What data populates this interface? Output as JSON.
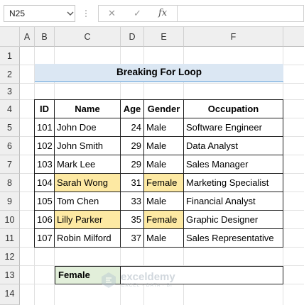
{
  "formula_bar": {
    "name_box": "N25",
    "cancel_symbol": "✕",
    "enter_symbol": "✓",
    "fx_symbol": "fx",
    "formula": ""
  },
  "columns": [
    "A",
    "B",
    "C",
    "D",
    "E",
    "F"
  ],
  "rows": [
    "1",
    "2",
    "3",
    "4",
    "5",
    "6",
    "7",
    "8",
    "9",
    "10",
    "11",
    "12",
    "13",
    "14"
  ],
  "title": "Breaking For Loop",
  "table": {
    "headers": [
      "ID",
      "Name",
      "Age",
      "Gender",
      "Occupation"
    ],
    "rows": [
      {
        "id": "101",
        "name": "John Doe",
        "age": "24",
        "gender": "Male",
        "occupation": "Software Engineer",
        "highlight": false
      },
      {
        "id": "102",
        "name": "John Smith",
        "age": "29",
        "gender": "Male",
        "occupation": "Data Analyst",
        "highlight": false
      },
      {
        "id": "103",
        "name": "Mark Lee",
        "age": "29",
        "gender": "Male",
        "occupation": "Sales Manager",
        "highlight": false
      },
      {
        "id": "104",
        "name": "Sarah Wong",
        "age": "31",
        "gender": "Female",
        "occupation": "Marketing Specialist",
        "highlight": true
      },
      {
        "id": "105",
        "name": "Tom Chen",
        "age": "33",
        "gender": "Male",
        "occupation": "Financial Analyst",
        "highlight": false
      },
      {
        "id": "106",
        "name": "Lilly Parker",
        "age": "35",
        "gender": "Female",
        "occupation": "Graphic Designer",
        "highlight": true
      },
      {
        "id": "107",
        "name": "Robin Milford",
        "age": "37",
        "gender": "Male",
        "occupation": "Sales Representative",
        "highlight": false
      }
    ]
  },
  "result": {
    "label": "Female",
    "value": ""
  },
  "watermark": {
    "name": "exceldemy",
    "tagline": "EXCEL · DATA · BI"
  },
  "colors": {
    "highlight": "#fde9a3",
    "title_fill": "#dbe7f3",
    "title_border": "#9dc3e6",
    "label_fill": "#e2efda"
  }
}
